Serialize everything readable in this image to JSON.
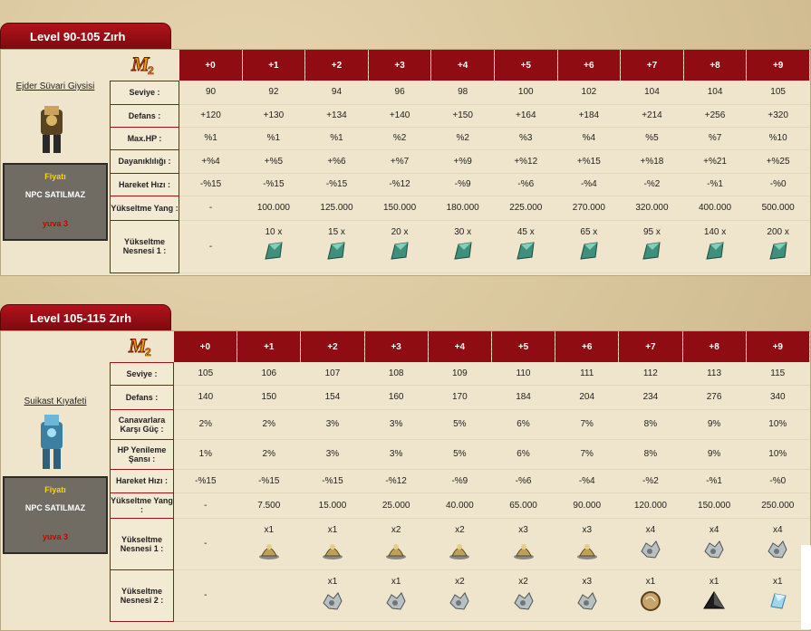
{
  "s1": {
    "tab": "Level 90-105 Zırh",
    "item_name": "Ejder Süvari Giysisi",
    "price": {
      "title": "Fiyatı",
      "value": "NPC SATILMAZ",
      "slot": "yuva 3"
    },
    "levels": [
      "+0",
      "+1",
      "+2",
      "+3",
      "+4",
      "+5",
      "+6",
      "+7",
      "+8",
      "+9"
    ],
    "rows": [
      {
        "label": "Seviye :",
        "values": [
          "90",
          "92",
          "94",
          "96",
          "98",
          "100",
          "102",
          "104",
          "104",
          "105"
        ]
      },
      {
        "label": "Defans :",
        "values": [
          "+120",
          "+130",
          "+134",
          "+140",
          "+150",
          "+164",
          "+184",
          "+214",
          "+256",
          "+320"
        ]
      },
      {
        "label": "Max.HP :",
        "values": [
          "%1",
          "%1",
          "%1",
          "%2",
          "%2",
          "%3",
          "%4",
          "%5",
          "%7",
          "%10"
        ]
      },
      {
        "label": "Dayanıklılığı :",
        "values": [
          "+%4",
          "+%5",
          "+%6",
          "+%7",
          "+%9",
          "+%12",
          "+%15",
          "+%18",
          "+%21",
          "+%25"
        ]
      },
      {
        "label": "Hareket Hızı :",
        "values": [
          "-%15",
          "-%15",
          "-%15",
          "-%12",
          "-%9",
          "-%6",
          "-%4",
          "-%2",
          "-%1",
          "-%0"
        ]
      },
      {
        "label": "Yükseltme Yang :",
        "values": [
          "-",
          "100.000",
          "125.000",
          "150.000",
          "180.000",
          "225.000",
          "270.000",
          "320.000",
          "400.000",
          "500.000"
        ]
      },
      {
        "label": "Yükseltme Nesnesi 1 :",
        "values": [
          "-",
          "10 x",
          "15 x",
          "20 x",
          "30 x",
          "45 x",
          "65 x",
          "95 x",
          "140 x",
          "200 x"
        ]
      }
    ]
  },
  "s2": {
    "tab": "Level 105-115 Zırh",
    "item_name": "Suikast Kıyafeti",
    "price": {
      "title": "Fiyatı",
      "value": "NPC SATILMAZ",
      "slot": "yuva 3"
    },
    "levels": [
      "+0",
      "+1",
      "+2",
      "+3",
      "+4",
      "+5",
      "+6",
      "+7",
      "+8",
      "+9"
    ],
    "rows": [
      {
        "label": "Seviye :",
        "values": [
          "105",
          "106",
          "107",
          "108",
          "109",
          "110",
          "111",
          "112",
          "113",
          "115"
        ]
      },
      {
        "label": "Defans :",
        "values": [
          "140",
          "150",
          "154",
          "160",
          "170",
          "184",
          "204",
          "234",
          "276",
          "340"
        ]
      },
      {
        "label": "Canavarlara Karşı Güç :",
        "values": [
          "2%",
          "2%",
          "3%",
          "3%",
          "5%",
          "6%",
          "7%",
          "8%",
          "9%",
          "10%"
        ]
      },
      {
        "label": "HP Yenileme Şansı :",
        "values": [
          "1%",
          "2%",
          "3%",
          "3%",
          "5%",
          "6%",
          "7%",
          "8%",
          "9%",
          "10%"
        ]
      },
      {
        "label": "Hareket Hızı :",
        "values": [
          "-%15",
          "-%15",
          "-%15",
          "-%12",
          "-%9",
          "-%6",
          "-%4",
          "-%2",
          "-%1",
          "-%0"
        ]
      },
      {
        "label": "Yükseltme Yang :",
        "values": [
          "-",
          "7.500",
          "15.000",
          "25.000",
          "40.000",
          "65.000",
          "90.000",
          "120.000",
          "150.000",
          "250.000"
        ]
      },
      {
        "label": "Yükseltme Nesnesi 1 :",
        "values": [
          "-",
          "x1",
          "x1",
          "x2",
          "x2",
          "x3",
          "x3",
          "x4",
          "x4",
          "x4"
        ],
        "icons": [
          "",
          "bell-icon",
          "bell-icon",
          "bell-icon",
          "bell-icon",
          "bell-icon",
          "bell-icon",
          "ore-icon",
          "ore-icon",
          "ore-icon"
        ]
      },
      {
        "label": "Yükseltme Nesnesi 2 :",
        "values": [
          "-",
          "",
          "x1",
          "x1",
          "x2",
          "x2",
          "x3",
          "x1",
          "x1",
          "x1"
        ],
        "icons": [
          "",
          "",
          "ore-icon",
          "ore-icon",
          "ore-icon",
          "ore-icon",
          "ore-icon",
          "orb-icon",
          "pyramid-icon",
          "crystal-icon"
        ]
      }
    ]
  },
  "colors": {
    "header": "#8e0c12",
    "label_border": "#9b1414",
    "panel": "#efe5cc"
  }
}
